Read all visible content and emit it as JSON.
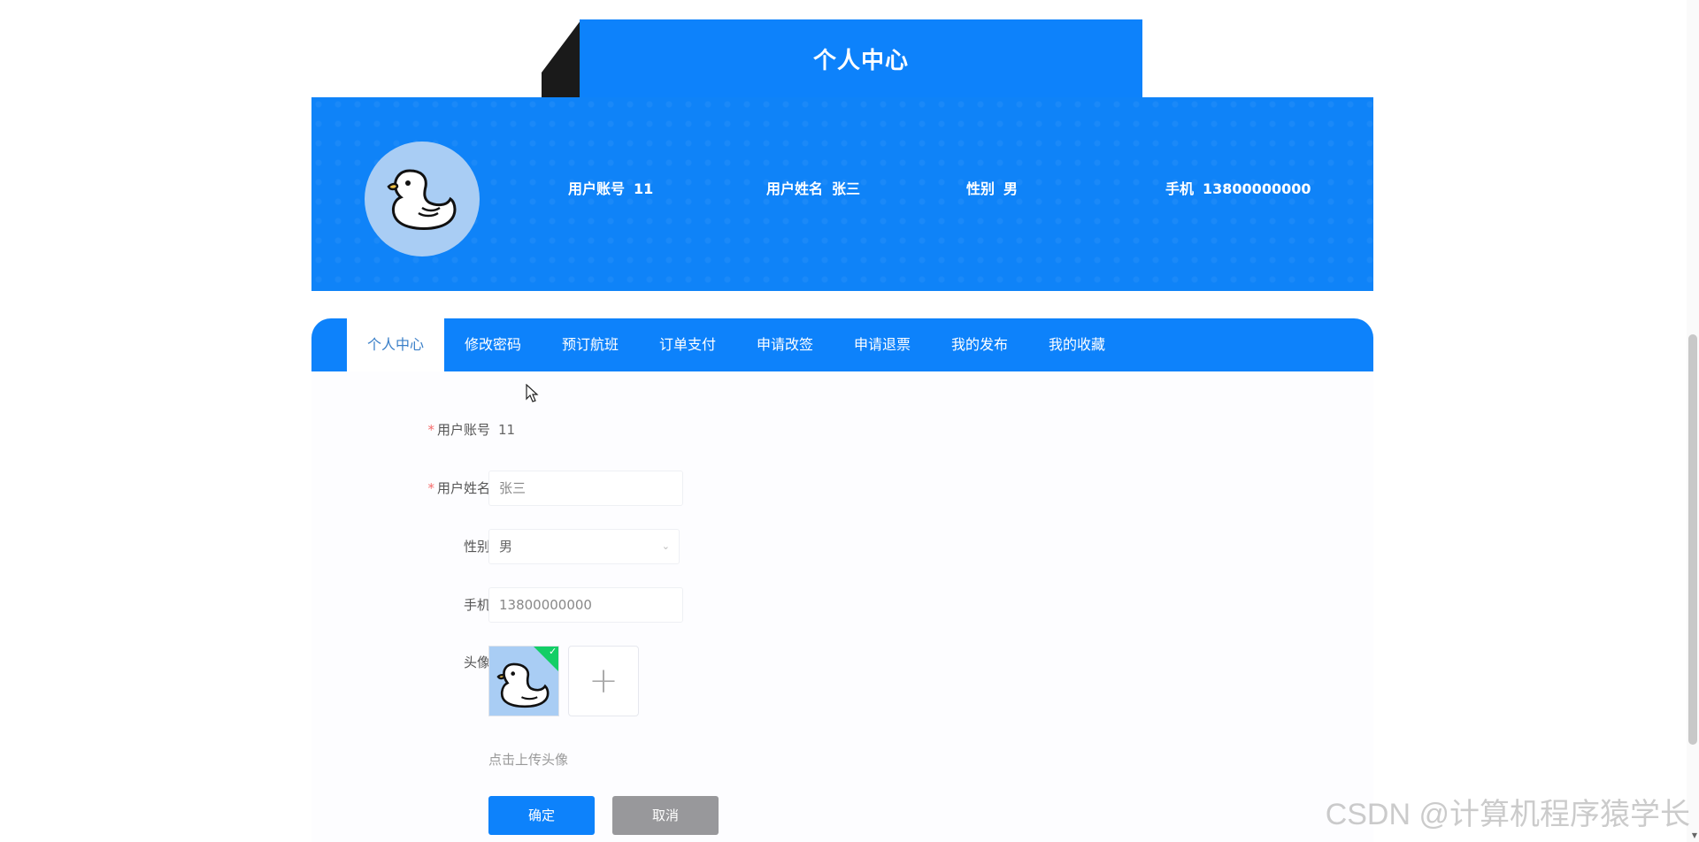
{
  "page_title": "个人中心",
  "profile": {
    "account_label": "用户账号",
    "account_value": "11",
    "name_label": "用户姓名",
    "name_value": "张三",
    "gender_label": "性别",
    "gender_value": "男",
    "phone_label": "手机",
    "phone_value": "13800000000"
  },
  "tabs": [
    {
      "label": "个人中心",
      "active": true
    },
    {
      "label": "修改密码",
      "active": false
    },
    {
      "label": "预订航班",
      "active": false
    },
    {
      "label": "订单支付",
      "active": false
    },
    {
      "label": "申请改签",
      "active": false
    },
    {
      "label": "申请退票",
      "active": false
    },
    {
      "label": "我的发布",
      "active": false
    },
    {
      "label": "我的收藏",
      "active": false
    }
  ],
  "form": {
    "required_mark": "*",
    "account_label": "用户账号",
    "account_value": "11",
    "name_label": "用户姓名",
    "name_value": "张三",
    "gender_label": "性别",
    "gender_value": "男",
    "phone_label": "手机",
    "phone_value": "13800000000",
    "avatar_label": "头像",
    "upload_plus": "+",
    "upload_tip": "点击上传头像",
    "check_mark": "✓",
    "chevron": "⌄"
  },
  "buttons": {
    "confirm": "确定",
    "cancel": "取消"
  },
  "watermark": "CSDN @计算机程序猿学长",
  "colors": {
    "primary": "#0d82fb",
    "cancel": "#98989b",
    "success": "#13ce66",
    "avatar_bg": "#a9cdf4"
  },
  "icons": {
    "avatar": "duck-avatar-icon",
    "upload": "plus-icon",
    "check": "check-icon",
    "select": "chevron-down-icon",
    "cursor": "mouse-cursor-icon"
  }
}
